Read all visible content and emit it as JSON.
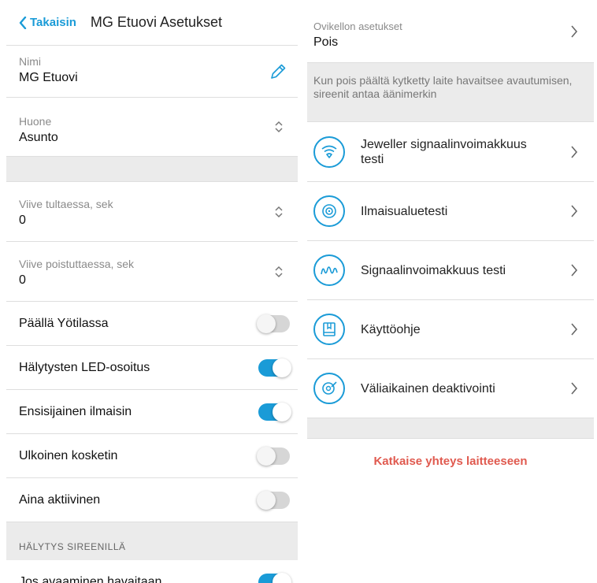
{
  "header": {
    "back_label": "Takaisin",
    "title": "MG Etuovi Asetukset"
  },
  "name_field": {
    "label": "Nimi",
    "value": "MG Etuovi"
  },
  "room_field": {
    "label": "Huone",
    "value": "Asunto"
  },
  "delay_in": {
    "label": "Viive tultaessa, sek",
    "value": "0"
  },
  "delay_out": {
    "label": "Viive poistuttaessa, sek",
    "value": "0"
  },
  "toggles": [
    {
      "label": "Päällä Yötilassa",
      "on": false
    },
    {
      "label": "Hälytysten LED-osoitus",
      "on": true
    },
    {
      "label": "Ensisijainen ilmaisin",
      "on": true
    },
    {
      "label": "Ulkoinen kosketin",
      "on": false
    },
    {
      "label": "Aina aktiivinen",
      "on": false
    }
  ],
  "siren_section": {
    "title": "HÄLYTYS SIREENILLÄ",
    "item_label": "Jos avaaminen havaitaan",
    "item_on": true
  },
  "doorbell": {
    "label": "Ovikellon asetukset",
    "value": "Pois"
  },
  "info_text": "Kun pois päältä kytketty laite havaitsee avautumisen, sireenit antaa äänimerkin",
  "menu": [
    {
      "label": "Jeweller signaalinvoimakkuus testi",
      "icon": "signal-wifi-icon"
    },
    {
      "label": "Ilmaisualuetesti",
      "icon": "detection-zone-icon"
    },
    {
      "label": "Signaalinvoimakkuus testi",
      "icon": "signal-wave-icon"
    },
    {
      "label": "Käyttöohje",
      "icon": "manual-book-icon"
    },
    {
      "label": "Väliaikainen deaktivointi",
      "icon": "deactivate-icon"
    }
  ],
  "disconnect_label": "Katkaise yhteys laitteeseen",
  "colors": {
    "accent": "#1a9bd7",
    "danger": "#e05a4f",
    "toggle_off": "#d6d6d6"
  }
}
